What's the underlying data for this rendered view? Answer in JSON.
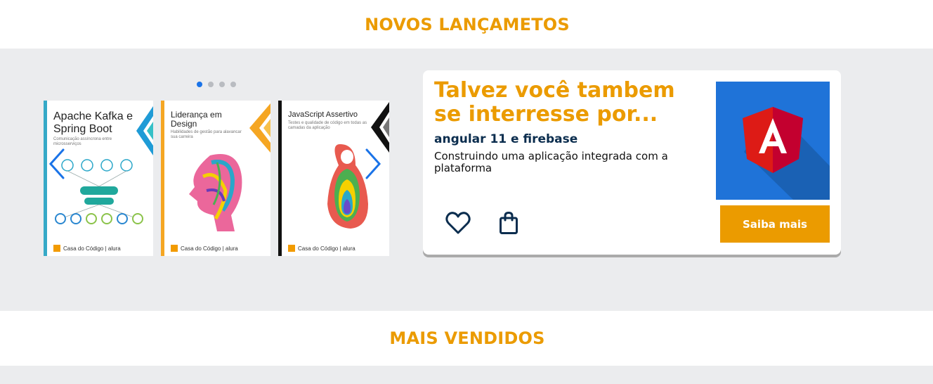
{
  "sections": {
    "new_releases_title": "NOVOS LANÇAMETOS",
    "best_sellers_title": "MAIS VENDIDOS"
  },
  "carousel": {
    "dots": 4,
    "active_dot": 0,
    "books": [
      {
        "title": "Apache Kafka e Spring Boot",
        "subtitle": "Comunicação assíncrona entre microsserviços",
        "accent": "#1f9bd6",
        "brand": "Casa do Código | alura"
      },
      {
        "title": "Liderança em Design",
        "subtitle": "Habilidades de gestão para alavancar sua carreira",
        "accent": "#f5a623",
        "brand": "Casa do Código | alura"
      },
      {
        "title": "JavaScript Assertivo",
        "subtitle": "Testes e qualidade de código em todas as camadas da aplicação",
        "accent": "#111111",
        "brand": "Casa do Código | alura"
      }
    ]
  },
  "card": {
    "heading": "Talvez você tambem se interresse por...",
    "subtitle": "angular 11 e firebase",
    "description": "Construindo uma aplicação integrada com a plataforma",
    "button_label": "Saiba mais",
    "icons": [
      "heart-icon",
      "shopping-bag-icon"
    ]
  },
  "colors": {
    "accent": "#eb9b00",
    "navy": "#0b2d4e",
    "band": "#ebecee",
    "carousel_arrow": "#1a73e8",
    "angular_bg": "#1f73d8",
    "angular_red": "#dd1b16"
  }
}
